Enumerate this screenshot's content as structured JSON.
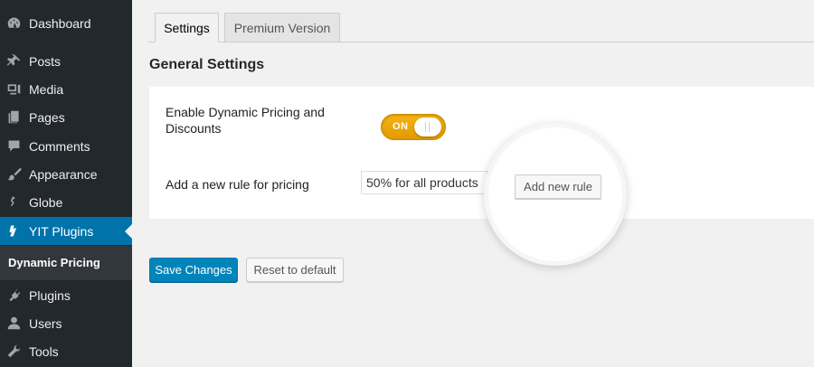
{
  "sidebar": {
    "items": [
      {
        "label": "Dashboard",
        "icon": "dashboard-icon"
      },
      {
        "label": "Posts",
        "icon": "pin-icon"
      },
      {
        "label": "Media",
        "icon": "media-icon"
      },
      {
        "label": "Pages",
        "icon": "pages-icon"
      },
      {
        "label": "Comments",
        "icon": "comments-icon"
      },
      {
        "label": "Appearance",
        "icon": "brush-icon"
      },
      {
        "label": "Globe",
        "icon": "globe-icon"
      },
      {
        "label": "YIT Plugins",
        "icon": "yit-icon"
      },
      {
        "label": "Plugins",
        "icon": "plug-icon"
      },
      {
        "label": "Users",
        "icon": "user-icon"
      },
      {
        "label": "Tools",
        "icon": "wrench-icon"
      }
    ],
    "submenu": {
      "label": "Dynamic Pricing"
    }
  },
  "tabs": [
    {
      "label": "Settings",
      "active": true
    },
    {
      "label": "Premium Version",
      "active": false
    }
  ],
  "page": {
    "heading": "General Settings"
  },
  "settings": {
    "enable_label": "Enable Dynamic Pricing and Discounts",
    "toggle_text": "ON",
    "rule_label": "Add a new rule for pricing",
    "rule_value": "50% for all products",
    "add_rule_label": "Add new rule"
  },
  "actions": {
    "save_label": "Save Changes",
    "reset_label": "Reset to default"
  },
  "colors": {
    "sidebar_bg": "#23282d",
    "active_bg": "#0073aa",
    "toggle": "#f6b314",
    "primary_button": "#0085ba"
  }
}
